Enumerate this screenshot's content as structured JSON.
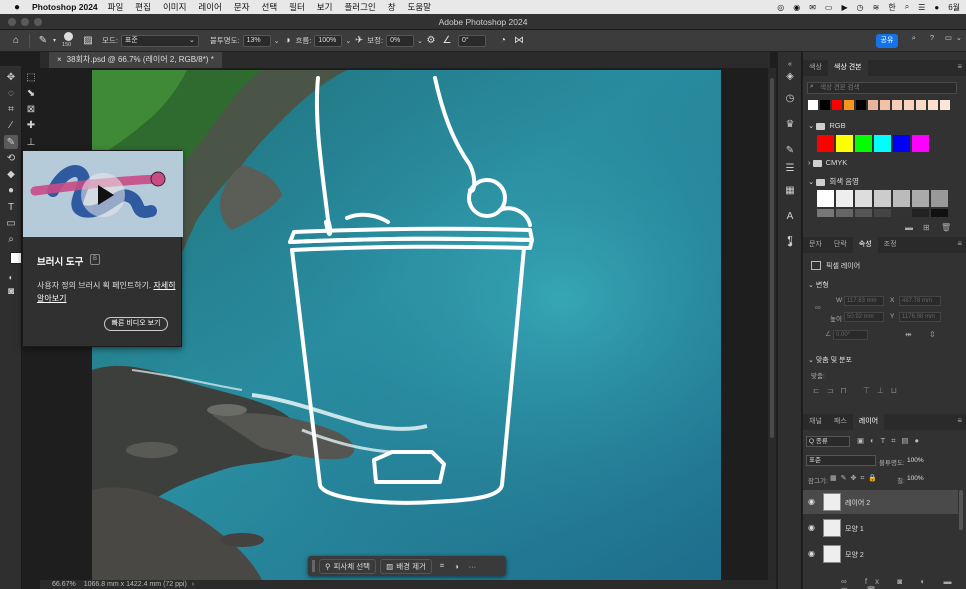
{
  "menubar": {
    "app_name": "Photoshop 2024",
    "items": [
      "파일",
      "편집",
      "이미지",
      "레이어",
      "문자",
      "선택",
      "필터",
      "보기",
      "플러그인",
      "창",
      "도움말"
    ],
    "clock": "6월"
  },
  "window": {
    "title": "Adobe Photoshop 2024"
  },
  "options_bar": {
    "brush_size": "150",
    "mode_label": "모드:",
    "mode_value": "표준",
    "opacity_label": "불투명도:",
    "opacity_value": "13%",
    "flow_label": "흐름:",
    "flow_value": "100%",
    "smoothing_label": "보정:",
    "smoothing_value": "0%",
    "angle_value": "0°",
    "share_label": "공유"
  },
  "document": {
    "tab_title": "38회차.psd @ 66.7% (레이어 2, RGB/8*) *",
    "zoom": "66.67%",
    "doc_info": "1066.8 mm x 1422.4 mm (72 ppi)"
  },
  "tooltip": {
    "title": "브러시 도구",
    "shortcut": "B",
    "description": "사용자 정의 브러시 획 페인트하기.",
    "learn_more": "자세히 알아보기",
    "video_button": "빠른 비디오 보기"
  },
  "swatches_panel": {
    "tabs": [
      "색상",
      "색상 견본"
    ],
    "search_placeholder": "색상 견본 검색",
    "recent_colors": [
      "#ffffff",
      "#000000",
      "#ff0000",
      "#f7941d",
      "#000000",
      "#e8b49a",
      "#f2c2a8",
      "#f6ccb4",
      "#f8d4c0",
      "#f9dac8",
      "#fbe0cf",
      "#fde6d8"
    ],
    "groups": [
      {
        "name": "RGB",
        "expanded": true,
        "colors": [
          "#ff0000",
          "#ffff00",
          "#00ff00",
          "#00ffff",
          "#0000ff",
          "#ff00ff"
        ]
      },
      {
        "name": "CMYK",
        "expanded": false
      },
      {
        "name": "회색 음영",
        "expanded": true,
        "colors": [
          "#ffffff",
          "#eeeeee",
          "#dddddd",
          "#cccccc",
          "#bbbbbb",
          "#aaaaaa",
          "#999999",
          "#888888"
        ]
      }
    ]
  },
  "properties_panel": {
    "tabs": [
      "문자",
      "단락",
      "속성",
      "조정"
    ],
    "active_tab": "속성",
    "layer_type": "픽셀 레이어",
    "transform_header": "변형",
    "w_label": "W",
    "w_value": "117.83 mm",
    "x_label": "X",
    "x_value": "487.78 mm",
    "h_label": "높이",
    "h_value": "50.92 mm",
    "y_label": "Y",
    "y_value": "1176.98 mm",
    "angle_value": "0.00°",
    "align_header": "맞춤 및 분포",
    "align_label": "맞춤:"
  },
  "layers_panel": {
    "tabs": [
      "채널",
      "패스",
      "레이어"
    ],
    "active_tab": "레이어",
    "filter_label": "Q 종류",
    "blend_mode": "표준",
    "opacity_label": "불투명도:",
    "opacity_value": "100%",
    "lock_label": "잠그기:",
    "fill_label": "칠:",
    "fill_value": "100%",
    "layers": [
      {
        "name": "레이어 2",
        "selected": true
      },
      {
        "name": "모양 1",
        "selected": false
      },
      {
        "name": "모양 2",
        "selected": false
      }
    ]
  },
  "contextual_taskbar": {
    "select_subject": "피사체 선택",
    "remove_bg": "배경 제거",
    "more": "···"
  }
}
